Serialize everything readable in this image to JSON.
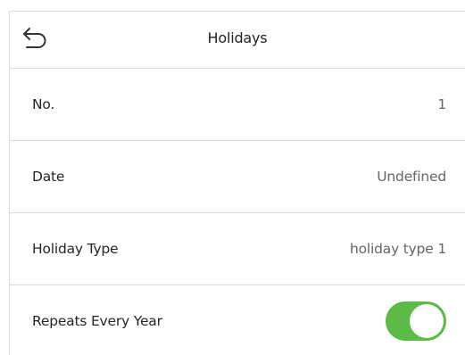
{
  "header": {
    "title": "Holidays",
    "back_icon": "back-arrow-icon"
  },
  "rows": [
    {
      "label": "No.",
      "value": "1"
    },
    {
      "label": "Date",
      "value": "Undefined"
    },
    {
      "label": "Holiday Type",
      "value": "holiday type 1"
    },
    {
      "label": "Repeats Every Year",
      "toggle_on": true
    }
  ],
  "colors": {
    "toggle_on": "#5cba47",
    "divider": "#dcdcdc"
  }
}
